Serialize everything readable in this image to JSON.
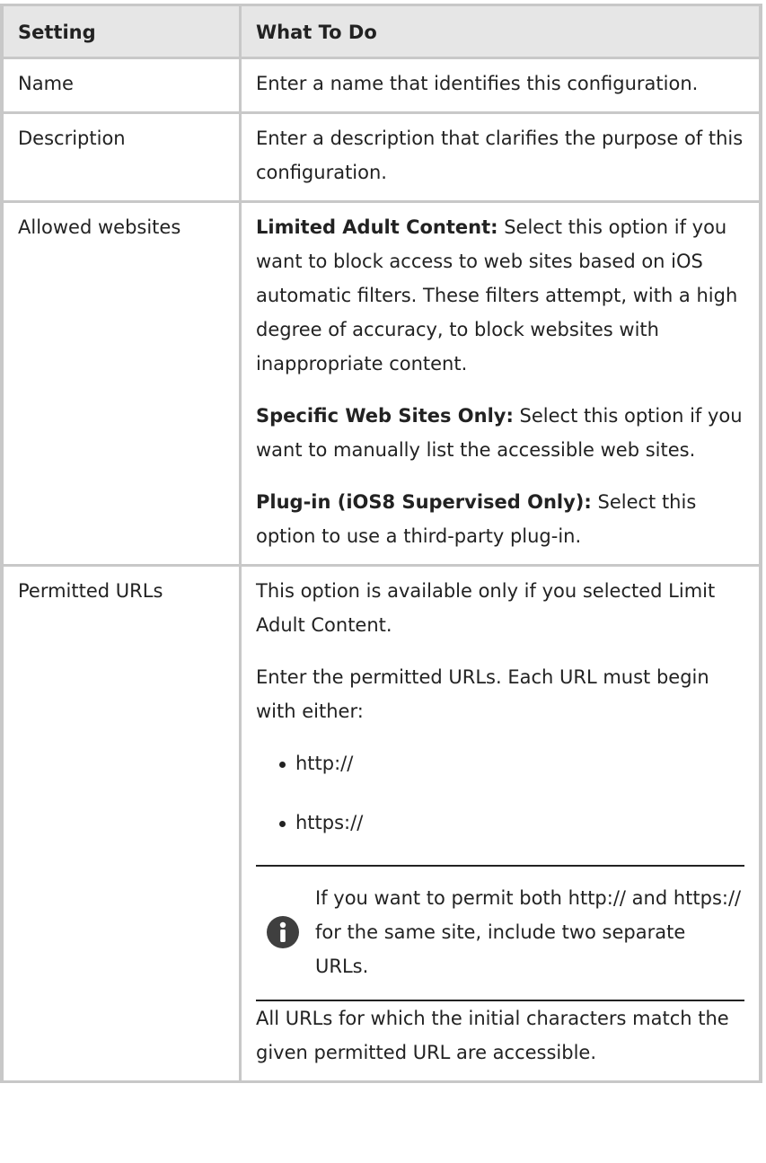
{
  "table": {
    "headers": [
      "Setting",
      "What To Do"
    ],
    "rows": {
      "name": {
        "setting": "Name",
        "text": "Enter a name that identifies this configuration."
      },
      "description": {
        "setting": "Description",
        "text": "Enter a description that clarifies the purpose of this configuration."
      },
      "allowed": {
        "setting": "Allowed websites",
        "items": [
          {
            "label": "Limited Adult Content:",
            "text": " Select this option if you want to block access to web sites based on iOS automatic filters. These filters attempt, with a high degree of accuracy, to block websites with inappropriate content."
          },
          {
            "label": "Specific Web Sites Only:",
            "text": " Select this option if you want to manually list the accessible web sites."
          },
          {
            "label": "Plug-in (iOS8 Supervised Only):",
            "text": " Select this option to use a third-party plug-in."
          }
        ]
      },
      "permitted": {
        "setting": "Permitted URLs",
        "intro": "This option is available only if you selected Limit Adult Content.",
        "instruction": "Enter the permitted URLs. Each URL must begin with either:",
        "bullets": [
          "http://",
          "https://"
        ],
        "note": "If you want to permit both http:// and https:// for the same site, include two separate URLs.",
        "note_icon": "info-icon",
        "closing": "All URLs for which the initial characters match the given permitted URL are accessible."
      }
    }
  }
}
